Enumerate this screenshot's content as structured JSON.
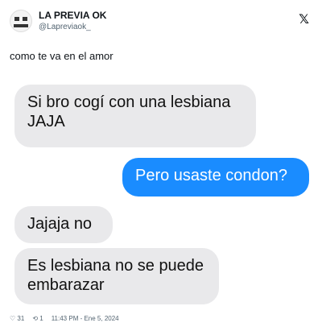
{
  "header": {
    "name": "LA PREVIA OK",
    "handle": "@Lapreviaok_",
    "x_logo": "𝕏"
  },
  "tweet": {
    "text": "como te va en el amor"
  },
  "chat": {
    "messages": [
      {
        "side": "received",
        "text": "Si bro cogí con una lesbiana JAJA"
      },
      {
        "side": "sent",
        "text": "Pero usaste condon?"
      },
      {
        "side": "received",
        "text": "Jajaja no"
      },
      {
        "side": "received",
        "text": "Es lesbiana no se puede embarazar"
      }
    ]
  },
  "footer": {
    "likes_icon": "♡",
    "likes": "31",
    "retweet_icon": "⟲",
    "retweets": "1",
    "timestamp": "11:43 PM - Ene 5, 2024"
  },
  "colors": {
    "sent_bubble": "#1a8cff",
    "received_bubble": "#e9e9eb"
  }
}
